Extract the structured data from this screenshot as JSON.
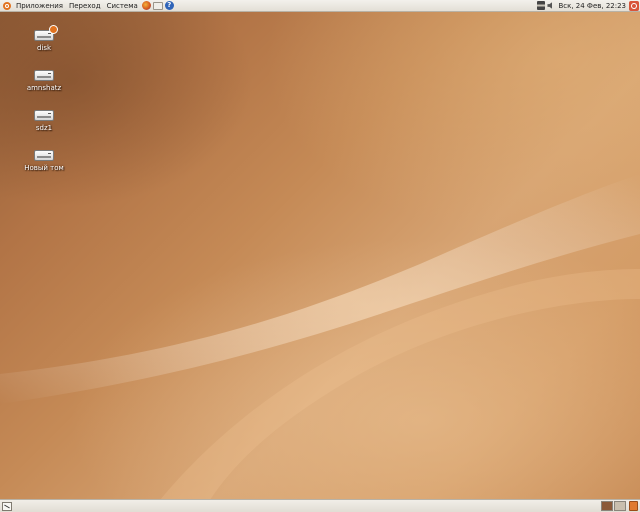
{
  "top_panel": {
    "menus": {
      "applications": "Приложения",
      "places": "Переход",
      "system": "Система"
    },
    "launchers": [
      "firefox-icon",
      "mail-icon",
      "help-icon"
    ],
    "help_glyph": "?",
    "clock": "Вск, 24 Фев, 22:23"
  },
  "desktop": {
    "icons": [
      {
        "label": "disk",
        "icon": "drive-icon"
      },
      {
        "label": "amnshatz",
        "icon": "drive-icon"
      },
      {
        "label": "sdz1",
        "icon": "drive-icon"
      },
      {
        "label": "Новый том",
        "icon": "drive-icon"
      }
    ]
  },
  "bottom_panel": {
    "workspaces": [
      {
        "active": true
      },
      {
        "active": false
      }
    ]
  },
  "colors": {
    "accent": "#e1721e",
    "desktop_dark": "#8f5b36",
    "desktop_light": "#d7a473",
    "panel": "#ece9e3"
  }
}
